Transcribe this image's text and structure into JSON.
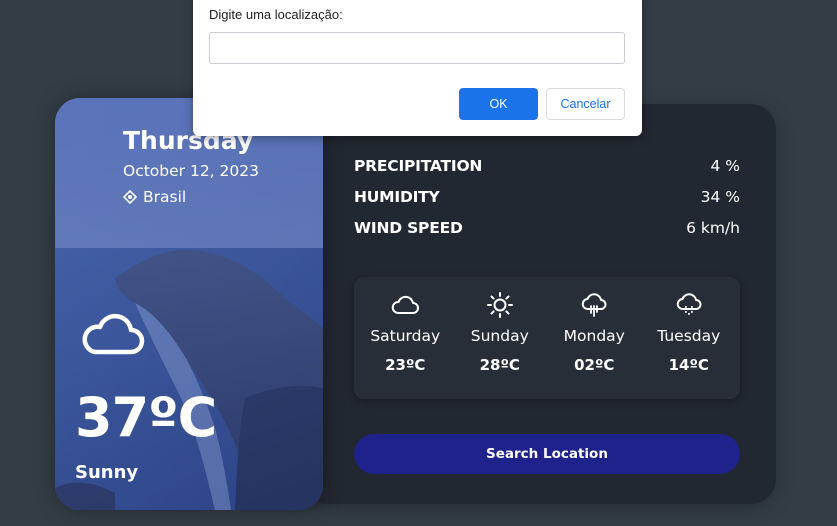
{
  "dialog": {
    "message": "Digite uma localização:",
    "input_value": "",
    "ok_label": "OK",
    "cancel_label": "Cancelar"
  },
  "card": {
    "day": "Thursday",
    "date": "October 12, 2023",
    "location": "Brasil",
    "location_icon": "location-pin-icon",
    "weather_icon": "cloud-icon",
    "temperature": "37ºC",
    "description": "Sunny"
  },
  "stats": [
    {
      "label": "PRECIPITATION",
      "value": "4 %"
    },
    {
      "label": "HUMIDITY",
      "value": "34 %"
    },
    {
      "label": "WIND SPEED",
      "value": "6 km/h"
    }
  ],
  "forecast": [
    {
      "day": "Saturday",
      "temp": "23ºC",
      "icon": "cloud-icon"
    },
    {
      "day": "Sunday",
      "temp": "28ºC",
      "icon": "sun-icon"
    },
    {
      "day": "Monday",
      "temp": "02ºC",
      "icon": "rain-cloud-icon"
    },
    {
      "day": "Tuesday",
      "temp": "14ºC",
      "icon": "rain-cloud-icon"
    }
  ],
  "search_button_label": "Search Location",
  "colors": {
    "background": "#343d46",
    "panel": "#222831",
    "forecast_box": "#272e37",
    "search_button": "#1e228a",
    "dialog_ok": "#1a73e8"
  }
}
